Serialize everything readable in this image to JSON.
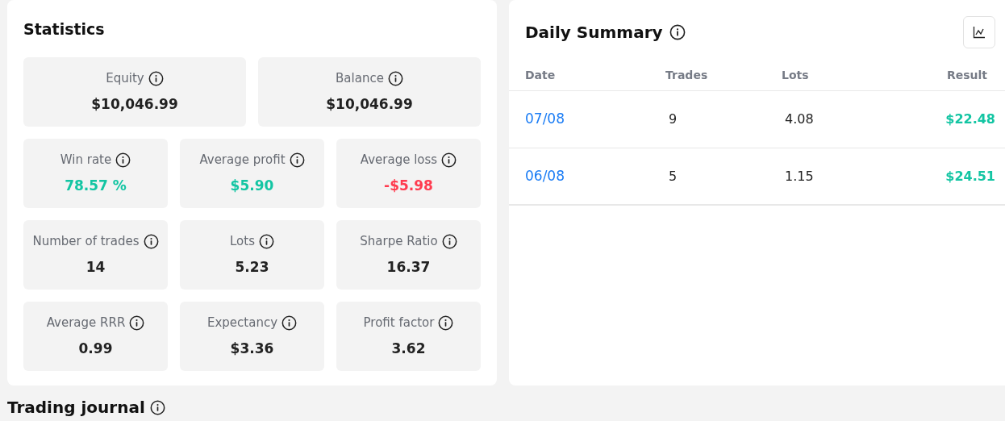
{
  "statistics": {
    "title": "Statistics",
    "top": [
      {
        "label": "Equity",
        "value": "$10,046.99",
        "color": "#222222"
      },
      {
        "label": "Balance",
        "value": "$10,046.99",
        "color": "#222222"
      }
    ],
    "grid": [
      {
        "label": "Win rate",
        "value": "78.57 %",
        "color": "#13c5a3"
      },
      {
        "label": "Average profit",
        "value": "$5.90",
        "color": "#13c5a3"
      },
      {
        "label": "Average loss",
        "value": "-$5.98",
        "color": "#ff3b4f"
      },
      {
        "label": "Number of trades",
        "value": "14",
        "color": "#222222"
      },
      {
        "label": "Lots",
        "value": "5.23",
        "color": "#222222"
      },
      {
        "label": "Sharpe Ratio",
        "value": "16.37",
        "color": "#222222"
      },
      {
        "label": "Average RRR",
        "value": "0.99",
        "color": "#222222"
      },
      {
        "label": "Expectancy",
        "value": "$3.36",
        "color": "#222222"
      },
      {
        "label": "Profit factor",
        "value": "3.62",
        "color": "#222222"
      }
    ]
  },
  "daily_summary": {
    "title": "Daily Summary",
    "columns": [
      "Date",
      "Trades",
      "Lots",
      "Result"
    ],
    "rows": [
      {
        "date": "07/08",
        "trades": "9",
        "lots": "4.08",
        "result": "$22.48",
        "color": "#13c5a3"
      },
      {
        "date": "06/08",
        "trades": "5",
        "lots": "1.15",
        "result": "$24.51",
        "color": "#13c5a3"
      }
    ]
  },
  "trading_journal": {
    "title": "Trading journal"
  }
}
